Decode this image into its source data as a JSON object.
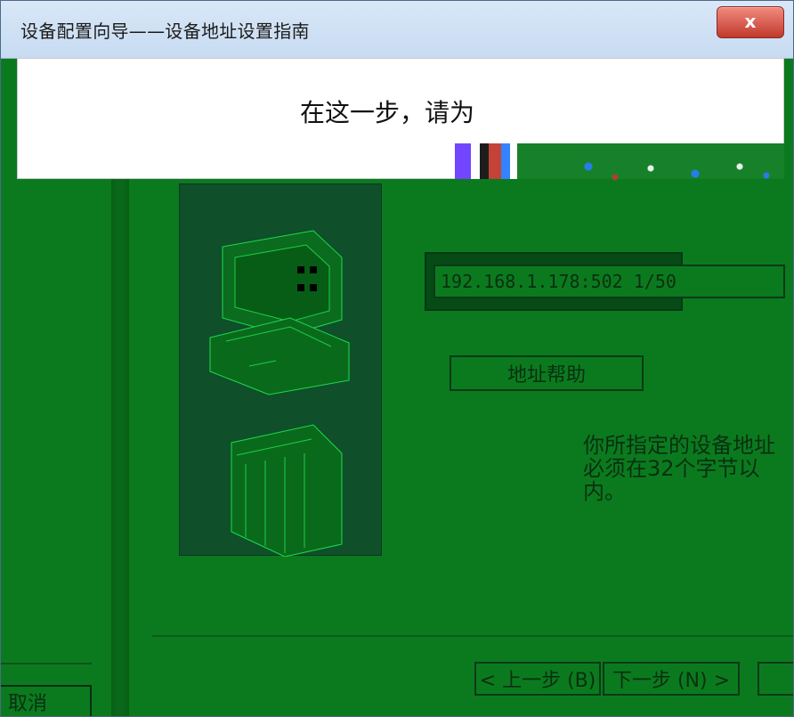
{
  "window": {
    "title": "设备配置向导——设备地址设置指南",
    "close_label": "x"
  },
  "header": {
    "instruction_text": "在这一步，请为"
  },
  "device_address": {
    "value": "192.168.1.178:502 1/50"
  },
  "buttons": {
    "address_help": "地址帮助",
    "prev": "< 上一步 (B)",
    "next": "下一步 (N) >",
    "cancel": "取消"
  },
  "note": {
    "text": "你所指定的设备地址必须在32个字节以内。"
  },
  "icons": {
    "computer": "computer-icon",
    "server": "server-icon",
    "close": "close-icon"
  },
  "colors": {
    "primary_green": "#0b7a1f",
    "panel_green": "#0f4f2a",
    "close_red": "#c0392b"
  }
}
